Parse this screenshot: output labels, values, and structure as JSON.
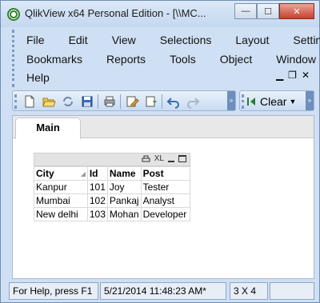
{
  "window": {
    "title": "QlikView x64 Personal Edition - [\\\\MC...",
    "controls": {
      "minimize": "—",
      "maximize": "☐",
      "close": "✕"
    }
  },
  "menu": {
    "row1": [
      "File",
      "Edit",
      "View",
      "Selections",
      "Layout",
      "Settings"
    ],
    "row2": [
      "Bookmarks",
      "Reports",
      "Tools",
      "Object",
      "Window"
    ],
    "row3": [
      "Help"
    ],
    "mdi_controls": {
      "minimize": "▁",
      "restore": "❐",
      "close": "✕"
    }
  },
  "toolbar": {
    "icons": [
      "new-document-icon",
      "open-folder-icon",
      "reload-icon",
      "save-icon",
      "print-icon",
      "edit-script-icon",
      "reload-data-icon",
      "undo-icon",
      "redo-icon"
    ],
    "more_label": "»"
  },
  "selection_toolbar": {
    "clear_label": "Clear",
    "more_label": "»"
  },
  "sheet_tabs": [
    {
      "label": "Main",
      "active": true
    }
  ],
  "table_box": {
    "caption_icons": [
      "print-icon",
      "XL",
      "minimize-icon",
      "maximize-icon"
    ],
    "columns": [
      "City",
      "Id",
      "Name",
      "Post"
    ],
    "rows": [
      [
        "Kanpur",
        "101",
        "Joy",
        "Tester"
      ],
      [
        "Mumbai",
        "102",
        "Pankaj",
        "Analyst"
      ],
      [
        "New delhi",
        "103",
        "Mohan",
        "Developer"
      ]
    ]
  },
  "status_bar": {
    "help": "For Help, press F1",
    "timestamp": "5/21/2014 11:48:23 AM*",
    "dimensions": "3 X 4"
  }
}
